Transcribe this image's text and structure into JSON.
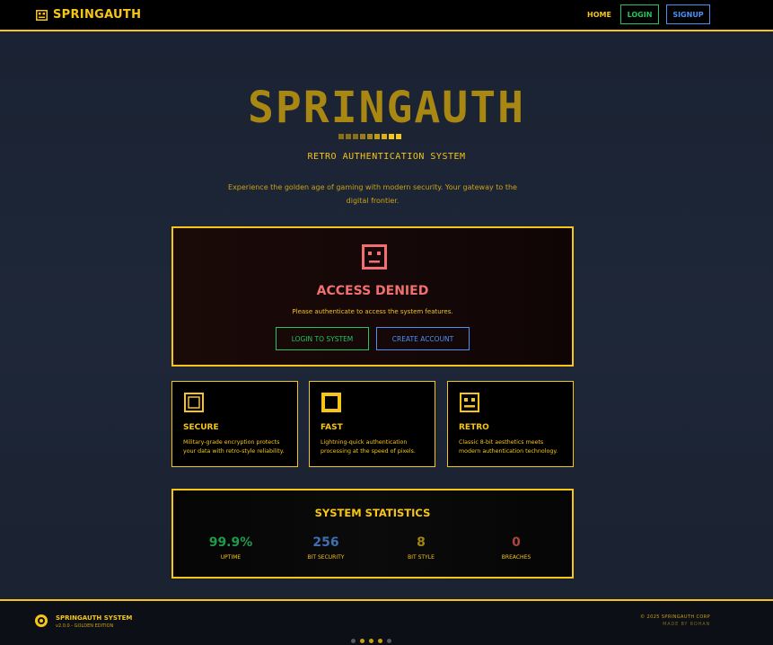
{
  "nav": {
    "brand": "SPRINGAUTH",
    "home": "HOME",
    "login": "LOGIN",
    "signup": "SIGNUP"
  },
  "hero": {
    "title": "SPRINGAUTH",
    "subtitle": "RETRO AUTHENTICATION SYSTEM",
    "description": "Experience the golden age of gaming with modern security. Your gateway to the digital frontier."
  },
  "access": {
    "title": "ACCESS DENIED",
    "message": "Please authenticate to access the system features.",
    "login_button": "LOGIN TO SYSTEM",
    "create_button": "CREATE ACCOUNT"
  },
  "features": [
    {
      "icon": "square-outline-icon",
      "title": "SECURE",
      "description": "Military-grade encryption protects your data with retro-style reliability."
    },
    {
      "icon": "square-thick-icon",
      "title": "FAST",
      "description": "Lightning-quick authentication processing at the speed of pixels."
    },
    {
      "icon": "robot-face-icon",
      "title": "RETRO",
      "description": "Classic 8-bit aesthetics meets modern authentication technology."
    }
  ],
  "stats": {
    "title": "SYSTEM STATISTICS",
    "items": [
      {
        "value": "99.9%",
        "label": "UPTIME",
        "color": "#1f9a4a"
      },
      {
        "value": "256",
        "label": "BIT SECURITY",
        "color": "#3f6fb0"
      },
      {
        "value": "8",
        "label": "BIT STYLE",
        "color": "#a08512"
      },
      {
        "value": "0",
        "label": "BREACHES",
        "color": "#a8463e"
      }
    ]
  },
  "footer": {
    "name": "SPRINGAUTH SYSTEM",
    "version": "v2.0.0 - GOLDEN EDITION",
    "copyright": "© 2025 SPRINGAUTH CORP",
    "made_by": "MADE BY ROHAN"
  },
  "colors": {
    "accent": "#f5c518",
    "success": "#22c55e",
    "info": "#4c8ff5",
    "danger": "#f07070"
  }
}
